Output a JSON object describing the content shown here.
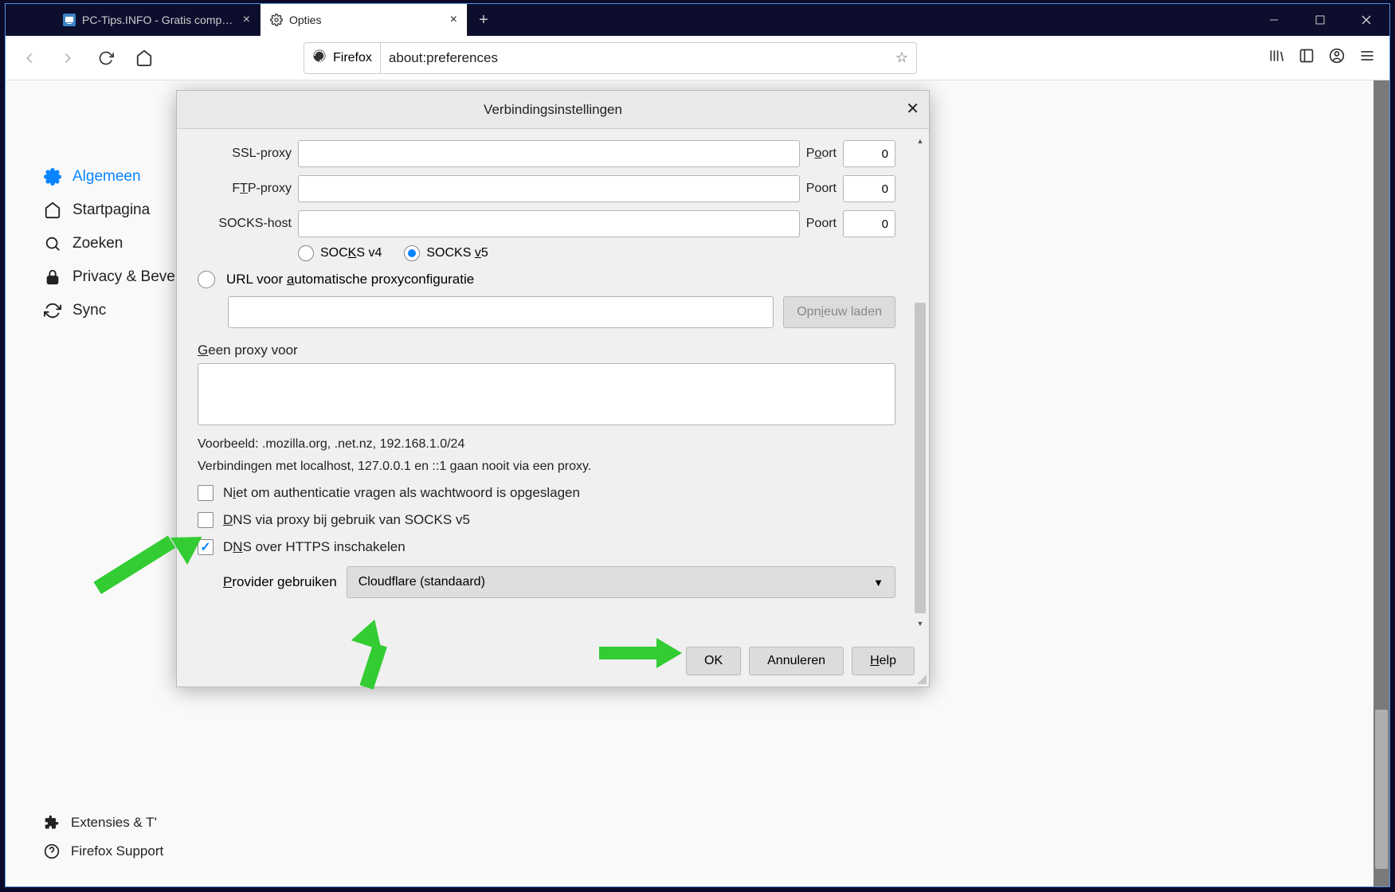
{
  "tabs": [
    {
      "label": "PC-Tips.INFO - Gratis compute…"
    },
    {
      "label": "Opties"
    }
  ],
  "urlbar": {
    "brand": "Firefox",
    "url": "about:preferences"
  },
  "sidebar": {
    "items": [
      {
        "label": "Algemeen"
      },
      {
        "label": "Startpagina"
      },
      {
        "label": "Zoeken"
      },
      {
        "label": "Privacy & Beve"
      },
      {
        "label": "Sync"
      }
    ],
    "bottom": [
      {
        "label": "Extensies & T'"
      },
      {
        "label": "Firefox Support"
      }
    ]
  },
  "dialog": {
    "title": "Verbindingsinstellingen",
    "ssl_label": "SSL-proxy",
    "ftp_label_pre": "F",
    "ftp_label_u": "T",
    "ftp_label_post": "P-proxy",
    "socks_label": "SOCKS-host",
    "port_label_p": "P",
    "port_label_o": "o",
    "port_label_ort": "ort",
    "port0": "0",
    "port1": "0",
    "port2": "0",
    "socks_v4_pre": "SOC",
    "socks_v4_u": "K",
    "socks_v4_post": "S v4",
    "socks_v5_pre": "SOCKS ",
    "socks_v5_u": "v",
    "socks_v5_post": "5",
    "autoproxy_pre": "URL voor ",
    "autoproxy_u": "a",
    "autoproxy_post": "utomatische proxyconfiguratie",
    "reload_pre": "Opn",
    "reload_u": "i",
    "reload_post": "euw laden",
    "no_proxy_u": "G",
    "no_proxy_post": "een proxy voor",
    "example": "Voorbeeld: .mozilla.org, .net.nz, 192.168.1.0/24",
    "localhost_note": "Verbindingen met localhost, 127.0.0.1 en ::1 gaan nooit via een proxy.",
    "chk1_pre": "N",
    "chk1_u": "i",
    "chk1_post": "et om authenticatie vragen als wachtwoord is opgeslagen",
    "chk2_u": "D",
    "chk2_post": "NS via proxy bij gebruik van SOCKS v5",
    "chk3_pre": "D",
    "chk3_u": "N",
    "chk3_post": "S over HTTPS inschakelen",
    "provider_u": "P",
    "provider_post": "rovider gebruiken",
    "provider_value": "Cloudflare (standaard)",
    "ok": "OK",
    "cancel": "Annuleren",
    "help_u": "H",
    "help_post": "elp"
  }
}
